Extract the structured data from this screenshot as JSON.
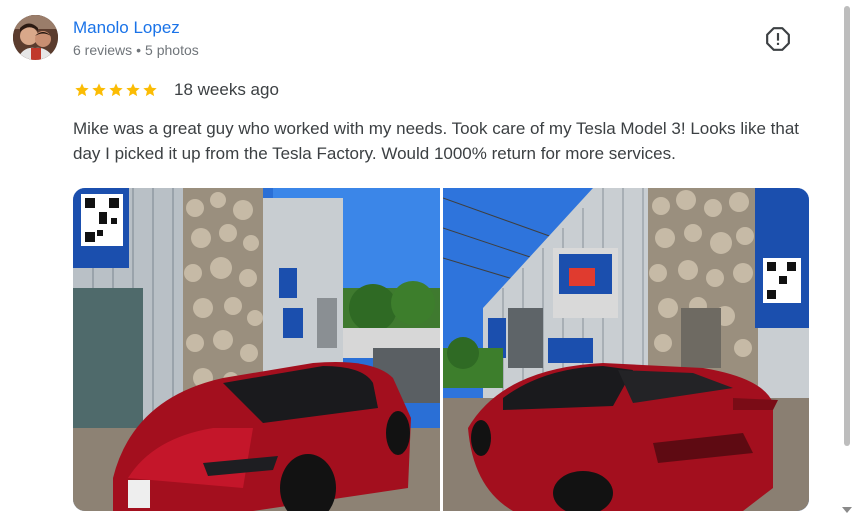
{
  "reviewer": {
    "name": "Manolo Lopez",
    "reviews": "6 reviews",
    "separator": "•",
    "photos": "5 photos",
    "avatar_icon": "user-avatar-photo"
  },
  "review": {
    "rating": 5,
    "max_rating": 5,
    "date": "18 weeks ago",
    "text": "Mike was a great guy who worked with my needs. Took care of my Tesla Model 3! Looks like that day I picked it up from the Tesla Factory. Would 1000% return for more services."
  },
  "photos": [
    {
      "subject": "red-tesla-front-view"
    },
    {
      "subject": "red-tesla-rear-view"
    }
  ],
  "icons": {
    "report": "report-icon",
    "star": "star-icon"
  },
  "colors": {
    "name_link": "#1a73e8",
    "star": "#fbbc04",
    "text": "#3c4043",
    "meta": "#70757a"
  }
}
